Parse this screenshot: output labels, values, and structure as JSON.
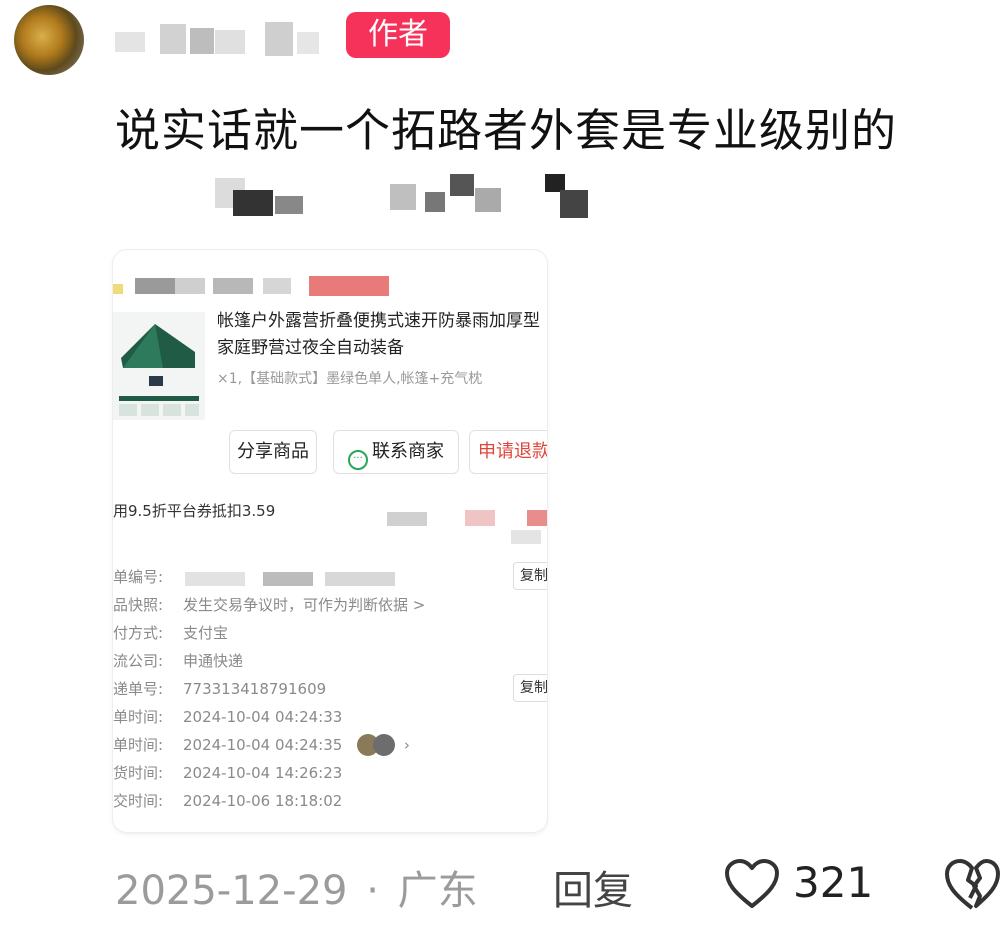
{
  "comment": {
    "badge": "作者",
    "text": "说实话就一个拓路者外套是专业级别的",
    "date": "2025-12-29",
    "separator": "·",
    "location": "广东",
    "reply_label": "回复",
    "like_count": "321",
    "icons": {
      "like": "heart-outline-icon",
      "dislike": "broken-heart-icon"
    }
  },
  "order": {
    "product_title": "帐篷户外露营折叠便携式速开防暴雨加厚型家庭野营过夜全自动装备",
    "product_spec": "×1,【基础款式】墨绿色单人,帐篷+充气枕",
    "buttons": {
      "share": "分享商品",
      "contact": "联系商家",
      "refund": "申请退款"
    },
    "coupon": "用9.5折平台券抵扣3.59",
    "copy_label": "复制",
    "rows": [
      {
        "label": "单编号:",
        "value": ""
      },
      {
        "label": "品快照:",
        "value": "发生交易争议时，可作为判断依据 >"
      },
      {
        "label": "付方式:",
        "value": "支付宝"
      },
      {
        "label": "流公司:",
        "value": "申通快递"
      },
      {
        "label": "递单号:",
        "value": "773313418791609"
      },
      {
        "label": "单时间:",
        "value": "2024-10-04 04:24:33"
      },
      {
        "label": "单时间:",
        "value": "2024-10-04 04:24:35"
      },
      {
        "label": "货时间:",
        "value": "2024-10-04 14:26:23"
      },
      {
        "label": "交时间:",
        "value": "2024-10-06 18:18:02"
      }
    ]
  },
  "colors": {
    "badge": "#f6325a",
    "refund_text": "#e0453a",
    "contact_icon": "#2aa65a"
  }
}
